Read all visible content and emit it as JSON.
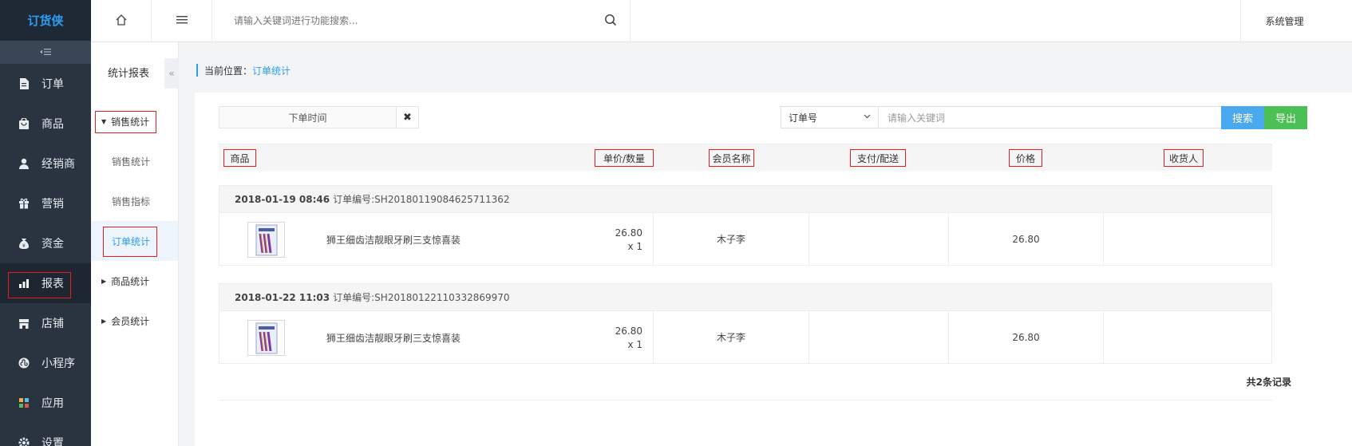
{
  "app": {
    "logo": "订货侠"
  },
  "sidebar": {
    "items": [
      {
        "label": "订单",
        "icon": "document-icon"
      },
      {
        "label": "商品",
        "icon": "bag-icon"
      },
      {
        "label": "经销商",
        "icon": "person-icon"
      },
      {
        "label": "营销",
        "icon": "gift-icon"
      },
      {
        "label": "资金",
        "icon": "money-bag-icon"
      },
      {
        "label": "报表",
        "icon": "bar-chart-icon",
        "active": true
      },
      {
        "label": "店铺",
        "icon": "store-icon"
      },
      {
        "label": "小程序",
        "icon": "mini-program-icon"
      },
      {
        "label": "应用",
        "icon": "apps-icon"
      },
      {
        "label": "设置",
        "icon": "gear-icon"
      }
    ]
  },
  "topbar": {
    "search_placeholder": "请输入关键词进行功能搜索...",
    "system_admin": "系统管理"
  },
  "subnav": {
    "title": "统计报表",
    "groups": [
      {
        "label": "销售统计",
        "expanded": true,
        "children": [
          "销售统计",
          "销售指标",
          "订单统计"
        ]
      },
      {
        "label": "商品统计"
      },
      {
        "label": "会员统计"
      }
    ],
    "active": "订单统计"
  },
  "breadcrumb": {
    "prefix": "当前位置：",
    "current": "订单统计"
  },
  "filters": {
    "date_label": "下单时间",
    "select_value": "订单号",
    "keyword_placeholder": "请输入关键词",
    "search_button": "搜索",
    "export_button": "导出"
  },
  "table": {
    "columns": [
      "商品",
      "单价/数量",
      "会员名称",
      "支付/配送",
      "价格",
      "收货人"
    ],
    "orders": [
      {
        "datetime": "2018-01-19 08:46",
        "order_no_label": "订单编号:SH20180119084625711362",
        "product": "狮王细齿洁靓眼牙刷三支惊喜装",
        "unit_price": "26.80",
        "qty": "x 1",
        "member": "木子李",
        "pay": "",
        "price": "26.80",
        "receiver": ""
      },
      {
        "datetime": "2018-01-22 11:03",
        "order_no_label": "订单编号:SH20180122110332869970",
        "product": "狮王细齿洁靓眼牙刷三支惊喜装",
        "unit_price": "26.80",
        "qty": "x 1",
        "member": "木子李",
        "pay": "",
        "price": "26.80",
        "receiver": ""
      }
    ],
    "total_text": "共2条记录"
  },
  "colors": {
    "accent": "#2a9df4",
    "search_btn": "#4aa8ef",
    "export_btn": "#4cc055",
    "sidebar_bg": "#2a3340",
    "highlight": "#e02020"
  }
}
